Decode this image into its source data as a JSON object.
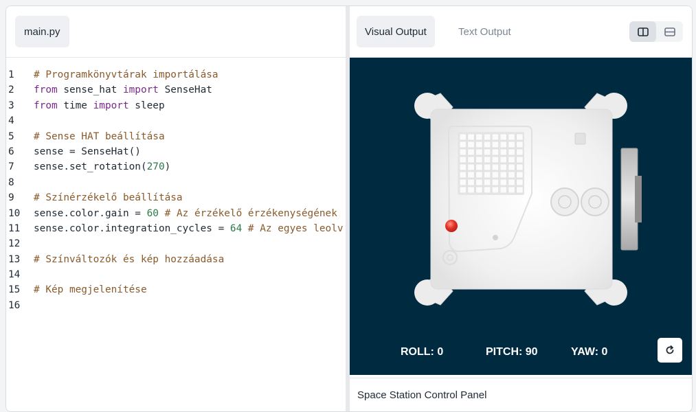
{
  "editor": {
    "file_tab": "main.py",
    "lines": [
      {
        "n": "1",
        "tokens": [
          {
            "t": "# Programkönyvtárak importálása",
            "c": "comment"
          }
        ]
      },
      {
        "n": "2",
        "tokens": [
          {
            "t": "from",
            "c": "kw"
          },
          {
            "t": " sense_hat ",
            "c": ""
          },
          {
            "t": "import",
            "c": "kw"
          },
          {
            "t": " SenseHat",
            "c": ""
          }
        ]
      },
      {
        "n": "3",
        "tokens": [
          {
            "t": "from",
            "c": "kw"
          },
          {
            "t": " time ",
            "c": ""
          },
          {
            "t": "import",
            "c": "kw"
          },
          {
            "t": " sleep",
            "c": ""
          }
        ]
      },
      {
        "n": "4",
        "tokens": []
      },
      {
        "n": "5",
        "tokens": [
          {
            "t": "# Sense HAT beállítása",
            "c": "comment"
          }
        ]
      },
      {
        "n": "6",
        "tokens": [
          {
            "t": "sense = SenseHat()",
            "c": ""
          }
        ]
      },
      {
        "n": "7",
        "tokens": [
          {
            "t": "sense.set_rotation(",
            "c": ""
          },
          {
            "t": "270",
            "c": "num"
          },
          {
            "t": ")",
            "c": ""
          }
        ]
      },
      {
        "n": "8",
        "tokens": []
      },
      {
        "n": "9",
        "tokens": [
          {
            "t": "# Színérzékelő beállítása",
            "c": "comment"
          }
        ]
      },
      {
        "n": "10",
        "tokens": [
          {
            "t": "sense.color.gain = ",
            "c": ""
          },
          {
            "t": "60",
            "c": "num"
          },
          {
            "t": " ",
            "c": ""
          },
          {
            "t": "# Az érzékelő érzékenységének",
            "c": "comment"
          }
        ]
      },
      {
        "n": "11",
        "tokens": [
          {
            "t": "sense.color.integration_cycles = ",
            "c": ""
          },
          {
            "t": "64",
            "c": "num"
          },
          {
            "t": " ",
            "c": ""
          },
          {
            "t": "# Az egyes leolv",
            "c": "comment"
          }
        ]
      },
      {
        "n": "12",
        "tokens": []
      },
      {
        "n": "13",
        "tokens": [
          {
            "t": "# Színváltozók és kép hozzáadása",
            "c": "comment"
          }
        ]
      },
      {
        "n": "14",
        "tokens": []
      },
      {
        "n": "15",
        "tokens": [
          {
            "t": "# Kép megjelenítése",
            "c": "comment"
          }
        ]
      },
      {
        "n": "16",
        "tokens": []
      }
    ]
  },
  "output": {
    "tabs": [
      {
        "label": "Visual Output",
        "active": true
      },
      {
        "label": "Text Output",
        "active": false
      }
    ],
    "layout_toggle": {
      "options": [
        "side-by-side-icon",
        "stacked-icon"
      ],
      "selected": "side-by-side-icon"
    },
    "readouts": {
      "roll": "ROLL: 0",
      "pitch": "PITCH: 90",
      "yaw": "YAW: 0"
    },
    "reset_icon": "refresh-icon",
    "panel_title": "Space Station Control Panel",
    "colors": {
      "viz_bg": "#002a3f",
      "led_red": "#e8302a",
      "comment": "#8a5a2b",
      "keyword": "#7a2a8a",
      "number": "#2b7a4b"
    }
  }
}
